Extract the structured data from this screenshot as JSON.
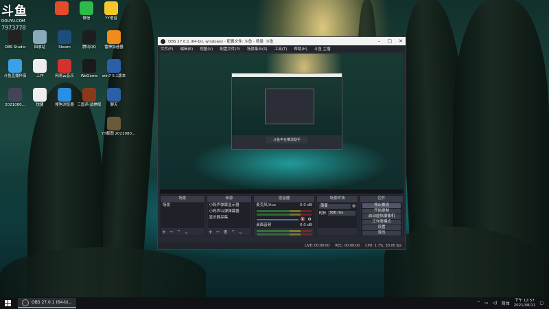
{
  "watermark": {
    "logo_text": "斗鱼",
    "site": "DOUYU.COM",
    "room": "7973778"
  },
  "desktop_icons": [
    {
      "label": "",
      "icon": "qq-icon",
      "color": "#e34b2d"
    },
    {
      "label": "微信",
      "icon": "wechat-icon",
      "color": "#2dbb4a"
    },
    {
      "label": "YY语音",
      "icon": "yy-icon",
      "color": "#f4c62c"
    },
    {
      "label": "OBS Studio",
      "icon": "obs-icon",
      "color": "#222"
    },
    {
      "label": "回收站",
      "icon": "recycle-bin-icon",
      "color": "#8ab"
    },
    {
      "label": "Steam",
      "icon": "steam-icon",
      "color": "#1b4e7a"
    },
    {
      "label": "腾讯QQ",
      "icon": "penguin-icon",
      "color": "#1e1e1e"
    },
    {
      "label": "雷神加速器",
      "icon": "thunder-icon",
      "color": "#f08c1a"
    },
    {
      "label": "斗鱼直播伴侣",
      "icon": "douyu-helper-icon",
      "color": "#3aa0e8"
    },
    {
      "label": "工作",
      "icon": "file-icon",
      "color": "#eee"
    },
    {
      "label": "网易云音乐",
      "icon": "netease-music-icon",
      "color": "#d4322c"
    },
    {
      "label": "WeGame",
      "icon": "wegame-icon",
      "color": "#1a1a1a"
    },
    {
      "label": "win7 5.1版本",
      "icon": "win7-icon",
      "color": "#2b5fa8"
    },
    {
      "label": "2021080...",
      "icon": "screenshot-icon",
      "color": "#445"
    },
    {
      "label": "快捷",
      "icon": "doc-icon",
      "color": "#eee"
    },
    {
      "label": "搜狗浏览器",
      "icon": "sogou-browser-icon",
      "color": "#2a8fe0"
    },
    {
      "label": "三国杀-战棋版",
      "icon": "sanguosha-icon",
      "color": "#8a3a1a"
    },
    {
      "label": "聊天",
      "icon": "chat-icon",
      "color": "#2b5fa8"
    },
    {
      "label": "YY截图 2021080...",
      "icon": "image-icon",
      "color": "#6a5a3a"
    }
  ],
  "obs": {
    "title": "OBS 27.0.1 (64-bit, windows) - 配置文件: 斗鱼 - 场景: 斗鱼",
    "menu": [
      "文件(F)",
      "编辑(E)",
      "视图(V)",
      "配置文件(P)",
      "场景集合(S)",
      "工具(T)",
      "帮助(H)",
      "斗鱼 主播"
    ],
    "docks": {
      "scenes": {
        "header": "场景",
        "items": [
          "场景"
        ]
      },
      "sources": {
        "header": "来源",
        "items": [
          "小妈声弹幕显示器",
          "小妈声山弹弹幕器",
          "显示器采集"
        ]
      },
      "mixer": {
        "header": "混音器",
        "tracks": [
          {
            "name": "麦克风/Aux",
            "level": "0.0 dB"
          },
          {
            "name": "桌面音频",
            "level": "0.0 dB"
          }
        ]
      },
      "transitions": {
        "header": "场景转场",
        "type": "渐变",
        "duration_label": "时长",
        "duration": "300 ms"
      },
      "controls": {
        "header": "控件",
        "buttons": [
          "停止推流",
          "开始录制",
          "启动虚拟摄像机",
          "工作室模式",
          "设置",
          "退出"
        ]
      }
    },
    "statusbar": {
      "live": "LIVE: 00:00:00",
      "rec": "REC: 00:00:00",
      "cpu": "CPU: 1.7%, 30.00 fps"
    },
    "nested_title": "斗鱼平台推流助手"
  },
  "taskbar": {
    "app_label": "OBS 27.0.1 (64-bi...",
    "ime": "简体",
    "time": "下午 12:57",
    "date": "2021/08/11"
  }
}
